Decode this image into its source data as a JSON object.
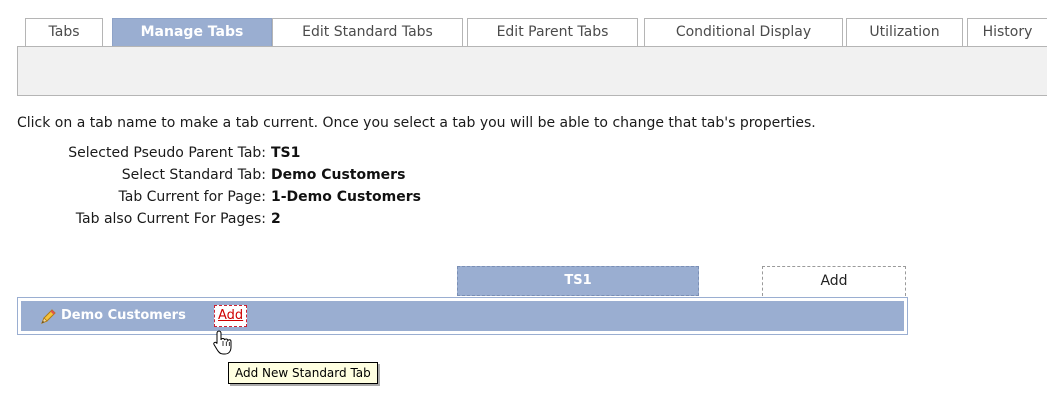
{
  "tabs": [
    {
      "label": "Tabs"
    },
    {
      "label": "Manage Tabs"
    },
    {
      "label": "Edit Standard Tabs"
    },
    {
      "label": "Edit Parent Tabs"
    },
    {
      "label": "Conditional Display"
    },
    {
      "label": "Utilization"
    },
    {
      "label": "History"
    }
  ],
  "active_tab": "Manage Tabs",
  "instruction": "Click on a tab name to make a tab current. Once you select a tab you will be able to change that tab's properties.",
  "properties": [
    {
      "label": "Selected Pseudo Parent Tab:",
      "value": "TS1"
    },
    {
      "label": "Select Standard Tab:",
      "value": "Demo Customers"
    },
    {
      "label": "Tab Current for Page:",
      "value": "1-Demo Customers"
    },
    {
      "label": "Tab also Current For Pages:",
      "value": "2"
    }
  ],
  "parent_tabs": {
    "selected_label": "TS1",
    "add_label": "Add"
  },
  "standard_tabs": {
    "item_label": "Demo Customers",
    "add_label": "Add"
  },
  "tooltip": "Add New Standard Tab",
  "colors": {
    "accent": "#9aaed1",
    "link_red": "#d00000",
    "tooltip_bg": "#ffffe1"
  },
  "icons": {
    "edit": "pencil-icon",
    "cursor": "hand-pointer-icon"
  }
}
